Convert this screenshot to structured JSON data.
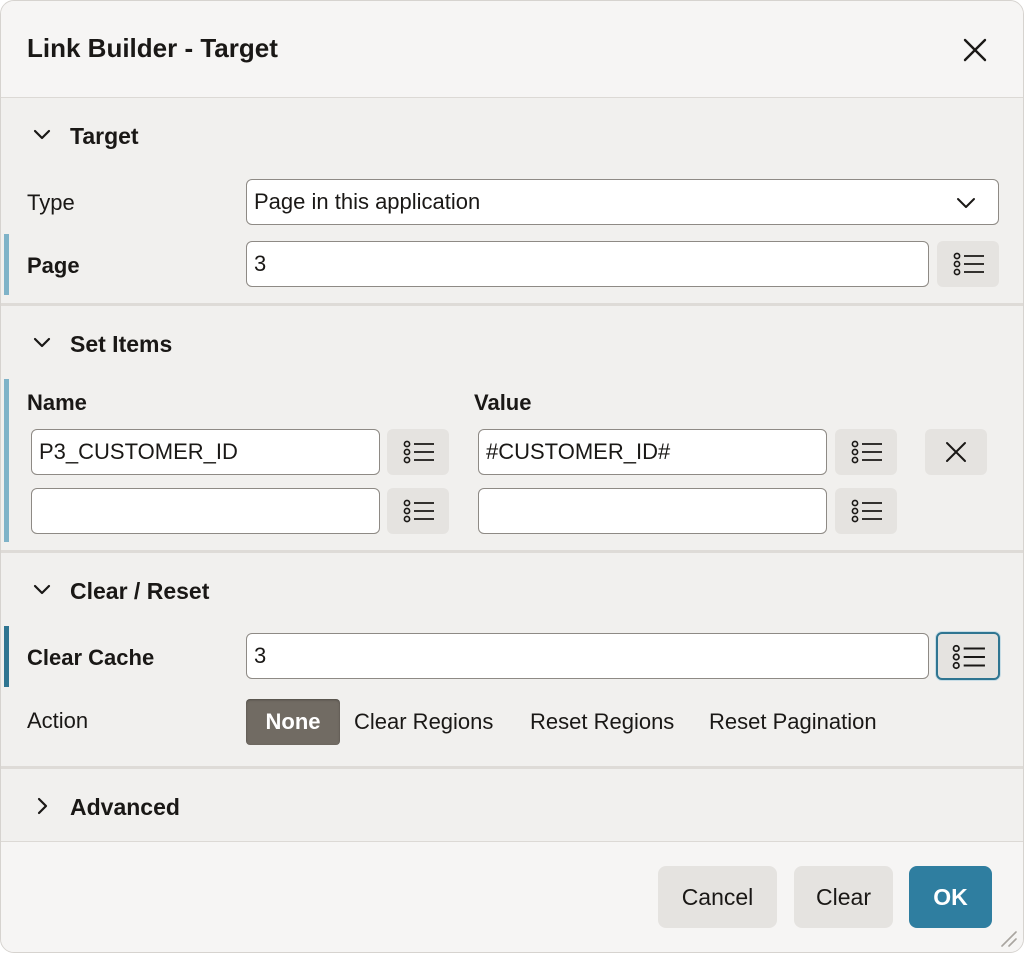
{
  "dialog": {
    "title": "Link Builder - Target",
    "close_icon": "close-icon"
  },
  "target_section": {
    "title": "Target",
    "expanded": true,
    "type_label": "Type",
    "type_value": "Page in this application",
    "page_label": "Page",
    "page_value": "3",
    "page_lov_icon": "list-icon"
  },
  "set_items_section": {
    "title": "Set Items",
    "expanded": true,
    "name_header": "Name",
    "value_header": "Value",
    "rows": [
      {
        "name": "P3_CUSTOMER_ID",
        "value": "#CUSTOMER_ID#",
        "removable": true
      },
      {
        "name": "",
        "value": "",
        "removable": false
      }
    ]
  },
  "clear_reset_section": {
    "title": "Clear / Reset",
    "expanded": true,
    "clear_cache_label": "Clear Cache",
    "clear_cache_value": "3",
    "action_label": "Action",
    "action_options": [
      "None",
      "Clear Regions",
      "Reset Regions",
      "Reset Pagination"
    ],
    "action_selected": "None"
  },
  "advanced_section": {
    "title": "Advanced",
    "expanded": false
  },
  "footer": {
    "cancel_label": "Cancel",
    "clear_label": "Clear",
    "ok_label": "OK"
  },
  "colors": {
    "primary": "#2f7ea0",
    "required_marker": "#7fb3c8",
    "selected_pill": "#716b63"
  }
}
